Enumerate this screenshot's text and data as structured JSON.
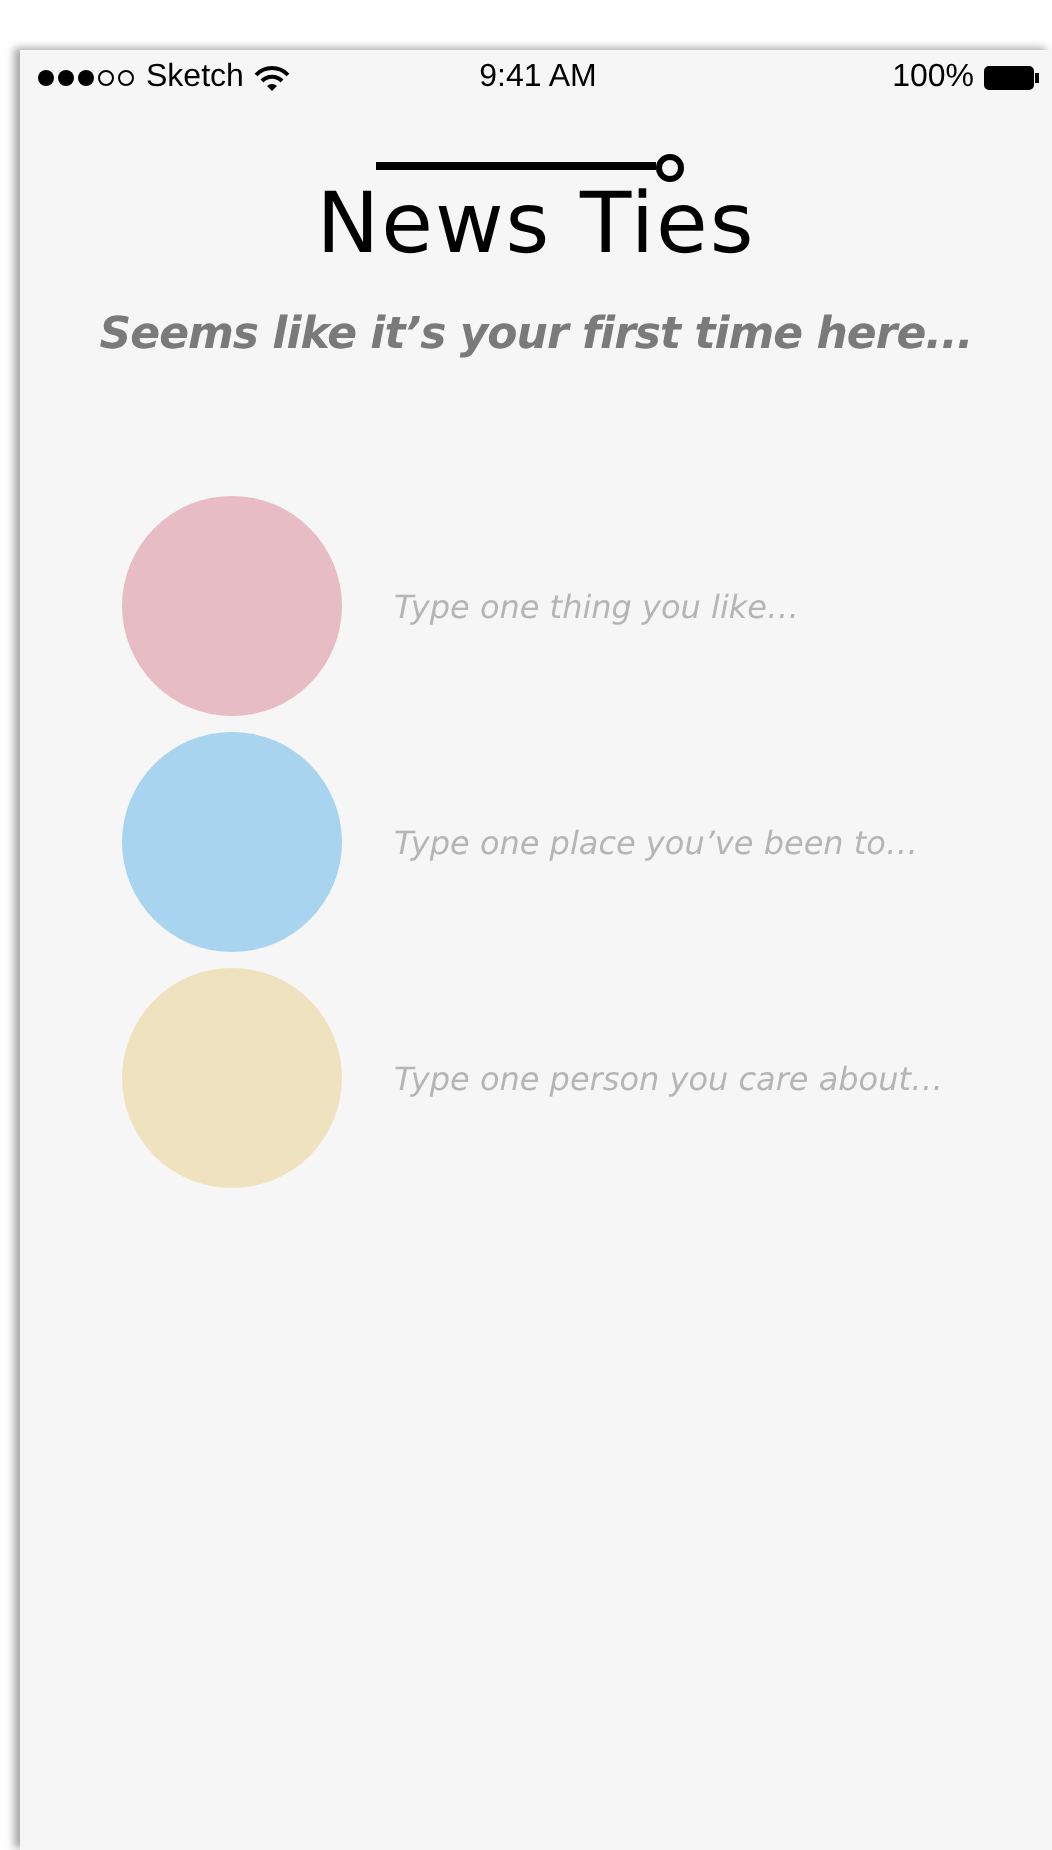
{
  "status_bar": {
    "carrier": "Sketch",
    "time": "9:41 AM",
    "battery": "100%"
  },
  "logo": "News Ties",
  "subtitle": "Seems like it’s your first time here...",
  "prompts": [
    {
      "color": "#e8bcc4",
      "placeholder": "Type one thing you like…"
    },
    {
      "color": "#a9d4ef",
      "placeholder": "Type one place you’ve been to…"
    },
    {
      "color": "#eee2bf",
      "placeholder": "Type one person you care about…"
    }
  ]
}
